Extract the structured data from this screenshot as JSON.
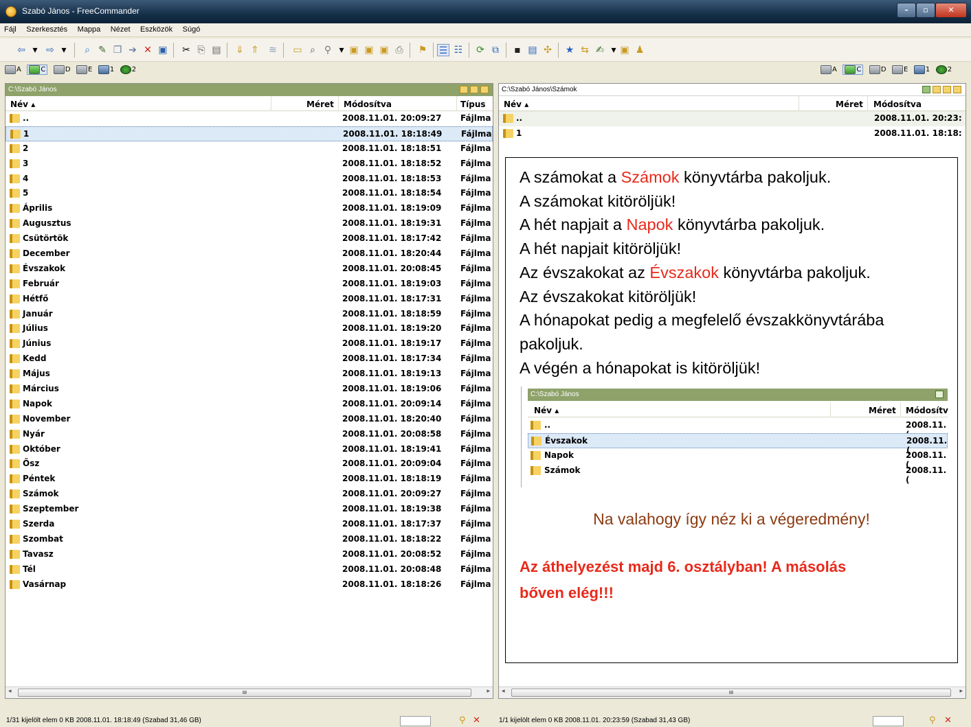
{
  "window": {
    "title": "Szabó János - FreeCommander"
  },
  "menu": [
    "Fájl",
    "Szerkesztés",
    "Mappa",
    "Nézet",
    "Eszközök",
    "Súgó"
  ],
  "drives": [
    {
      "label": "A",
      "icon": "floppy-drive-icon"
    },
    {
      "label": "C",
      "icon": "hard-drive-icon",
      "active": true
    },
    {
      "label": "D",
      "icon": "dvd-drive-icon"
    },
    {
      "label": "E",
      "icon": "removable-drive-icon"
    },
    {
      "label": "1",
      "icon": "network-drive-icon"
    },
    {
      "label": "2",
      "icon": "ftp-icon"
    }
  ],
  "left_panel": {
    "path": "C:\\Szabó János",
    "columns": {
      "name": "Név",
      "size": "Méret",
      "modified": "Módosítva",
      "type": "Típus"
    },
    "rows": [
      {
        "name": "..",
        "date": "2008.11.01. 20:09:27",
        "type": "Fájlma"
      },
      {
        "name": "1",
        "date": "2008.11.01. 18:18:49",
        "type": "Fájlma"
      },
      {
        "name": "2",
        "date": "2008.11.01. 18:18:51",
        "type": "Fájlma"
      },
      {
        "name": "3",
        "date": "2008.11.01. 18:18:52",
        "type": "Fájlma"
      },
      {
        "name": "4",
        "date": "2008.11.01. 18:18:53",
        "type": "Fájlma"
      },
      {
        "name": "5",
        "date": "2008.11.01. 18:18:54",
        "type": "Fájlma"
      },
      {
        "name": "Április",
        "date": "2008.11.01. 18:19:09",
        "type": "Fájlma"
      },
      {
        "name": "Augusztus",
        "date": "2008.11.01. 18:19:31",
        "type": "Fájlma"
      },
      {
        "name": "Csütörtök",
        "date": "2008.11.01. 18:17:42",
        "type": "Fájlma"
      },
      {
        "name": "December",
        "date": "2008.11.01. 18:20:44",
        "type": "Fájlma"
      },
      {
        "name": "Évszakok",
        "date": "2008.11.01. 20:08:45",
        "type": "Fájlma"
      },
      {
        "name": "Február",
        "date": "2008.11.01. 18:19:03",
        "type": "Fájlma"
      },
      {
        "name": "Hétfő",
        "date": "2008.11.01. 18:17:31",
        "type": "Fájlma"
      },
      {
        "name": "Január",
        "date": "2008.11.01. 18:18:59",
        "type": "Fájlma"
      },
      {
        "name": "Július",
        "date": "2008.11.01. 18:19:20",
        "type": "Fájlma"
      },
      {
        "name": "Június",
        "date": "2008.11.01. 18:19:17",
        "type": "Fájlma"
      },
      {
        "name": "Kedd",
        "date": "2008.11.01. 18:17:34",
        "type": "Fájlma"
      },
      {
        "name": "Május",
        "date": "2008.11.01. 18:19:13",
        "type": "Fájlma"
      },
      {
        "name": "Március",
        "date": "2008.11.01. 18:19:06",
        "type": "Fájlma"
      },
      {
        "name": "Napok",
        "date": "2008.11.01. 20:09:14",
        "type": "Fájlma"
      },
      {
        "name": "November",
        "date": "2008.11.01. 18:20:40",
        "type": "Fájlma"
      },
      {
        "name": "Nyár",
        "date": "2008.11.01. 20:08:58",
        "type": "Fájlma"
      },
      {
        "name": "Október",
        "date": "2008.11.01. 18:19:41",
        "type": "Fájlma"
      },
      {
        "name": "Ősz",
        "date": "2008.11.01. 20:09:04",
        "type": "Fájlma"
      },
      {
        "name": "Péntek",
        "date": "2008.11.01. 18:18:19",
        "type": "Fájlma"
      },
      {
        "name": "Számok",
        "date": "2008.11.01. 20:09:27",
        "type": "Fájlma"
      },
      {
        "name": "Szeptember",
        "date": "2008.11.01. 18:19:38",
        "type": "Fájlma"
      },
      {
        "name": "Szerda",
        "date": "2008.11.01. 18:17:37",
        "type": "Fájlma"
      },
      {
        "name": "Szombat",
        "date": "2008.11.01. 18:18:22",
        "type": "Fájlma"
      },
      {
        "name": "Tavasz",
        "date": "2008.11.01. 20:08:52",
        "type": "Fájlma"
      },
      {
        "name": "Tél",
        "date": "2008.11.01. 20:08:48",
        "type": "Fájlma"
      },
      {
        "name": "Vasárnap",
        "date": "2008.11.01. 18:18:26",
        "type": "Fájlma"
      }
    ],
    "selected_index": 1,
    "status": "1/31 kijelölt elem   0 KB  2008.11.01. 18:18:49    (Szabad 31,46 GB)"
  },
  "right_panel": {
    "path": "C:\\Szabó János\\Számok",
    "columns": {
      "name": "Név",
      "size": "Méret",
      "modified": "Módosítva"
    },
    "rows": [
      {
        "name": "..",
        "date": "2008.11.01. 20:23:"
      },
      {
        "name": "1",
        "date": "2008.11.01. 18:18:"
      }
    ],
    "status": "1/1 kijelölt elem   0 KB  2008.11.01. 20:23:59    (Szabad 31,43 GB)"
  },
  "overlay": {
    "lines": [
      {
        "parts": [
          "A számokat a ",
          "Számok",
          " könyvtárba pakoljuk."
        ]
      },
      {
        "parts": [
          "A számokat kitöröljük!"
        ]
      },
      {
        "parts": [
          "A hét napjait a ",
          "Napok",
          " könyvtárba pakoljuk."
        ]
      },
      {
        "parts": [
          "A hét napjait kitöröljük!"
        ]
      },
      {
        "parts": [
          "Az évszakokat az ",
          "Évszakok",
          " könyvtárba pakoljuk."
        ]
      },
      {
        "parts": [
          "Az évszakokat kitöröljük!"
        ]
      },
      {
        "parts": [
          "A hónapokat pedig a megfelelő évszakkönyvtárába"
        ]
      },
      {
        "parts": [
          "pakoljuk."
        ]
      },
      {
        "parts": [
          "A végén a hónapokat is kitöröljük!"
        ]
      }
    ],
    "inset": {
      "path": "C:\\Szabó János",
      "col_name": "Név",
      "col_size": "Méret",
      "col_modified": "Módosítv",
      "rows": [
        {
          "name": "..",
          "date": "2008.11.("
        },
        {
          "name": "Évszakok",
          "date": "2008.11.("
        },
        {
          "name": "Napok",
          "date": "2008.11.("
        },
        {
          "name": "Számok",
          "date": "2008.11.("
        }
      ]
    },
    "note": "Na valahogy így néz ki a végeredmény!",
    "warning_line1": "Az áthelyezést majd 6. osztályban! A másolás",
    "warning_line2": "bőven elég!!!"
  },
  "scrollbar_glyph": "III",
  "colors": {
    "active_path": "#8ea26a",
    "highlight_red": "#e8291a",
    "note_brown": "#8b3a10"
  }
}
